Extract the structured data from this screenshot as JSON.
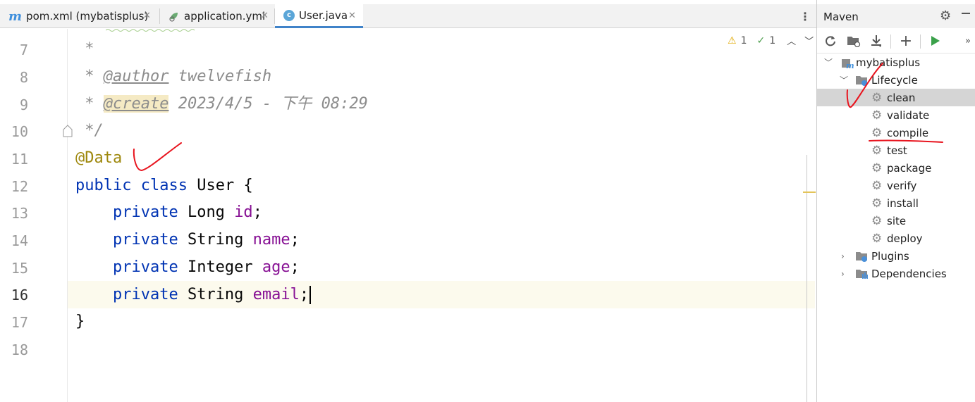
{
  "editor": {
    "tabs": [
      {
        "label": "pom.xml (mybatisplus)",
        "icon": "maven-m-icon",
        "active": false
      },
      {
        "label": "application.yml",
        "icon": "yaml-leaf-icon",
        "active": false
      },
      {
        "label": "User.java",
        "icon": "java-class-icon",
        "active": true
      }
    ],
    "close_glyph": "✕",
    "more_glyph": "⋮",
    "inspections": {
      "warnings": "1",
      "weak_warnings": "1"
    },
    "line_numbers": [
      "7",
      "8",
      "9",
      "10",
      "11",
      "12",
      "13",
      "14",
      "15",
      "16",
      "17",
      "18"
    ],
    "current_line": "16",
    "code": {
      "l7": " *",
      "l8_star": " * ",
      "l8_tag": "@author",
      "l8_rest": " twelvefish",
      "l9_star": " * ",
      "l9_tag": "@create",
      "l9_rest": " 2023/4/5 - 下午 08:29",
      "l10": " */",
      "l11": "@Data",
      "l12_kw1": "public",
      "l12_kw2": "class",
      "l12_rest": " User {",
      "l13_kw": "private",
      "l13_type": " Long ",
      "l13_field": "id",
      "l14_kw": "private",
      "l14_type": " String ",
      "l14_field": "name",
      "l15_kw": "private",
      "l15_type": " Integer ",
      "l15_field": "age",
      "l16_kw": "private",
      "l16_type": " String ",
      "l16_field": "email",
      "semicolon": ";",
      "l17": "}"
    }
  },
  "maven": {
    "title": "Maven",
    "project": "mybatisplus",
    "lifecycle_label": "Lifecycle",
    "lifecycle_phases": [
      "clean",
      "validate",
      "compile",
      "test",
      "package",
      "verify",
      "install",
      "site",
      "deploy"
    ],
    "selected_phase": "clean",
    "plugins_label": "Plugins",
    "dependencies_label": "Dependencies",
    "toolbar_icons": [
      "reload-icon",
      "add-folder-icon",
      "download-icon",
      "add-icon",
      "run-icon",
      "more-icon"
    ]
  },
  "colors": {
    "keyword": "#0033b3",
    "field": "#871094",
    "annotation": "#9e880d",
    "comment": "#8c8c8c",
    "pen": "#e8141e"
  }
}
